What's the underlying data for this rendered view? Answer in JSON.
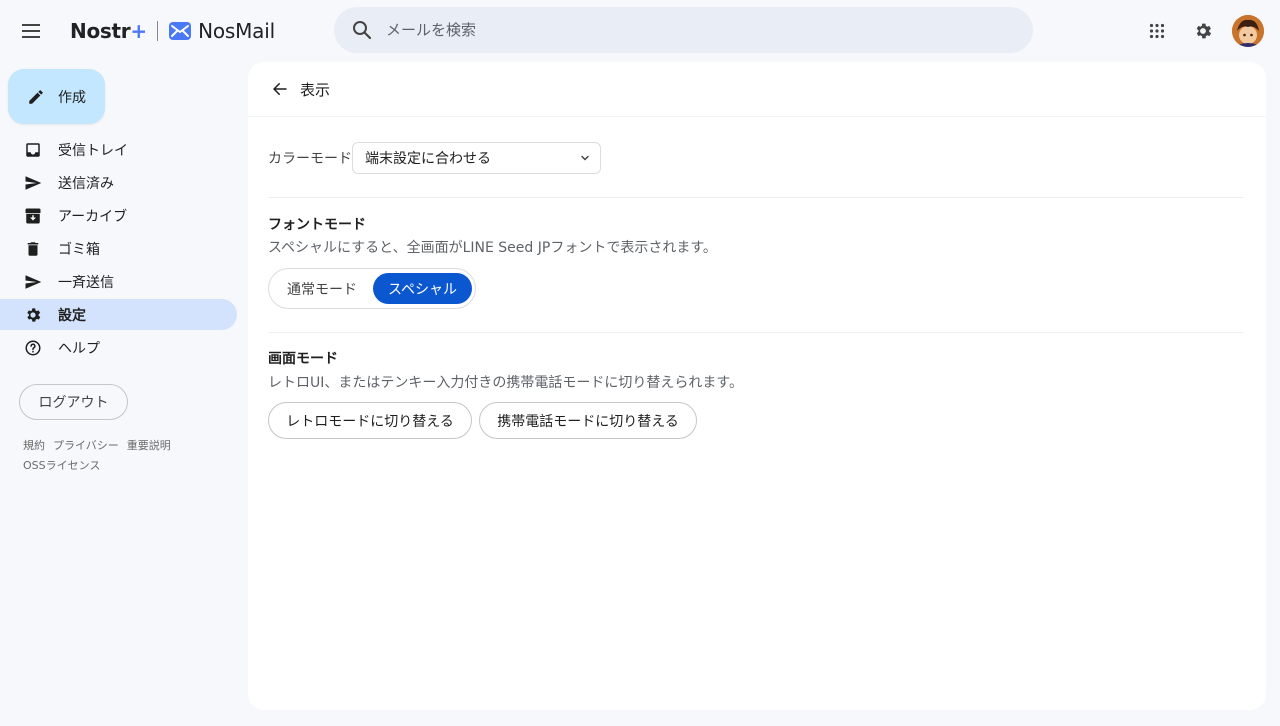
{
  "header": {
    "brand_nostr": "Nostr",
    "brand_plus": "+",
    "brand_separator": "|",
    "brand_app": "NosMail",
    "search_placeholder": "メールを検索",
    "icons": [
      "menu-icon",
      "search-icon",
      "apps-icon",
      "gear-icon",
      "avatar"
    ]
  },
  "sidebar": {
    "compose_label": "作成",
    "items": [
      {
        "label": "受信トレイ",
        "icon": "inbox-icon",
        "active": false
      },
      {
        "label": "送信済み",
        "icon": "send-icon",
        "active": false
      },
      {
        "label": "アーカイブ",
        "icon": "archive-icon",
        "active": false
      },
      {
        "label": "ゴミ箱",
        "icon": "trash-icon",
        "active": false
      },
      {
        "label": "一斉送信",
        "icon": "broadcast-icon",
        "active": false
      },
      {
        "label": "設定",
        "icon": "gear-icon",
        "active": true
      },
      {
        "label": "ヘルプ",
        "icon": "help-icon",
        "active": false
      }
    ],
    "logout_label": "ログアウト",
    "footer": {
      "terms": "規約",
      "privacy": "プライバシー",
      "important": "重要説明",
      "oss": "OSSライセンス"
    }
  },
  "main": {
    "title": "表示",
    "color_mode": {
      "label": "カラーモード",
      "selected": "端末設定に合わせる"
    },
    "font_mode": {
      "title": "フォントモード",
      "description": "スペシャルにすると、全画面がLINE Seed JPフォントで表示されます。",
      "options": [
        "通常モード",
        "スペシャル"
      ],
      "selected": "スペシャル"
    },
    "screen_mode": {
      "title": "画面モード",
      "description": "レトロUI、またはテンキー入力付きの携帯電話モードに切り替えられます。",
      "retro_button": "レトロモードに切り替える",
      "phone_button": "携帯電話モードに切り替える"
    }
  },
  "colors": {
    "background": "#f6f8fc",
    "accent": "#0b57d0",
    "compose_bg": "#c2e7ff",
    "active_nav": "#d3e3fd",
    "search_bg": "#e9eef6"
  }
}
